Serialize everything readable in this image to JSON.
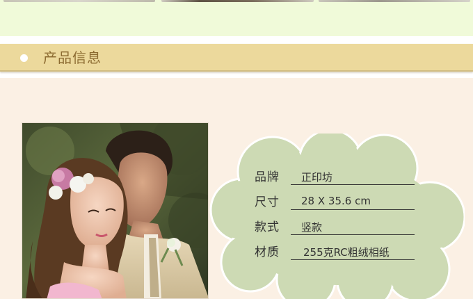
{
  "section_title": "产品信息",
  "specs": [
    {
      "label": "品牌",
      "value": "正印坊"
    },
    {
      "label": "尺寸",
      "value": "28 X 35.6 cm"
    },
    {
      "label": "款式",
      "value": "竖款"
    },
    {
      "label": "材质",
      "value": "255克RC粗绒相纸"
    }
  ],
  "colors": {
    "top_band": "#f0fad9",
    "title_bar": "#ecd99c",
    "title_text": "#8c6b31",
    "content_bg": "#fbf0e4",
    "cloud_fill": "#cddab4"
  },
  "icons": {
    "title_bullet": "white-dot-icon"
  }
}
